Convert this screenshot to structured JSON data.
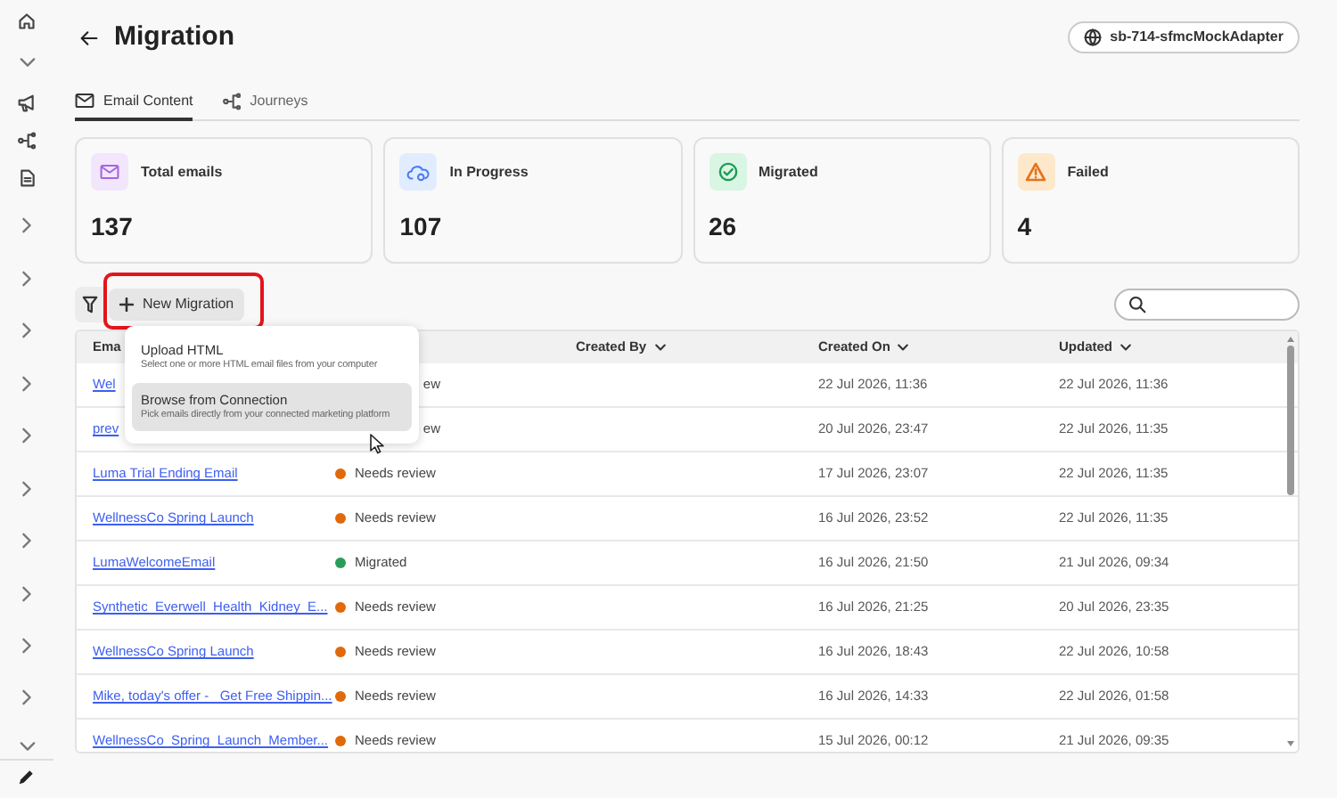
{
  "header": {
    "title": "Migration",
    "connection": "sb-714-sfmcMockAdapter"
  },
  "tabs": [
    {
      "label": "Email Content",
      "kind": "mail",
      "selected": true
    },
    {
      "label": "Journeys",
      "kind": "journey",
      "selected": false
    }
  ],
  "stats": [
    {
      "label": "Total emails",
      "value": "137",
      "kind": "mail"
    },
    {
      "label": "In Progress",
      "value": "107",
      "kind": "cloud"
    },
    {
      "label": "Migrated",
      "value": "26",
      "kind": "check"
    },
    {
      "label": "Failed",
      "value": "4",
      "kind": "warning"
    }
  ],
  "toolbar": {
    "new_button": "New Migration"
  },
  "menu": [
    {
      "title": "Upload HTML",
      "description": "Select one or more HTML email files from your computer",
      "selected": false
    },
    {
      "title": "Browse from Connection",
      "description": "Pick emails directly from your connected marketing platform",
      "selected": true
    }
  ],
  "table": {
    "columns": [
      {
        "label": "Ema",
        "sortable": false
      },
      {
        "label": "Created By",
        "sortable": true
      },
      {
        "label": "Created On",
        "sortable": true
      },
      {
        "label": "Updated",
        "sortable": true
      }
    ],
    "rows": [
      {
        "name": "Wel",
        "status": "ew",
        "kind": "covered",
        "created_on": "22 Jul 2026, 11:36",
        "updated": "22 Jul 2026, 11:36"
      },
      {
        "name": "prev",
        "status": "ew",
        "kind": "covered",
        "created_on": "20 Jul 2026, 23:47",
        "updated": "22 Jul 2026, 11:35"
      },
      {
        "name": "Luma Trial Ending Email",
        "status": "Needs review",
        "kind": "full",
        "color": "#e0690a",
        "created_on": "17 Jul 2026, 23:07",
        "updated": "22 Jul 2026, 11:35"
      },
      {
        "name": "WellnessCo Spring Launch",
        "status": "Needs review",
        "kind": "full",
        "color": "#e0690a",
        "created_on": "16 Jul 2026, 23:52",
        "updated": "22 Jul 2026, 11:35"
      },
      {
        "name": "LumaWelcomeEmail",
        "status": "Migrated",
        "kind": "full",
        "color": "#2a9d5a",
        "created_on": "16 Jul 2026, 21:50",
        "updated": "21 Jul 2026, 09:34"
      },
      {
        "name": "Synthetic_Everwell_Health_Kidney_E...",
        "status": "Needs review",
        "kind": "full",
        "color": "#e0690a",
        "created_on": "16 Jul 2026, 21:25",
        "updated": "20 Jul 2026, 23:35"
      },
      {
        "name": "WellnessCo Spring Launch",
        "status": "Needs review",
        "kind": "full",
        "color": "#e0690a",
        "created_on": "16 Jul 2026, 18:43",
        "updated": "22 Jul 2026, 10:58"
      },
      {
        "name": "Mike, today's offer -   Get Free Shippin...",
        "status": "Needs review",
        "kind": "full",
        "color": "#e0690a",
        "created_on": "16 Jul 2026, 14:33",
        "updated": "22 Jul 2026, 01:58"
      },
      {
        "name": "WellnessCo_Spring_Launch_Member...",
        "status": "Needs review",
        "kind": "full",
        "color": "#e0690a",
        "created_on": "15 Jul 2026, 00:12",
        "updated": "21 Jul 2026, 09:35"
      }
    ]
  }
}
